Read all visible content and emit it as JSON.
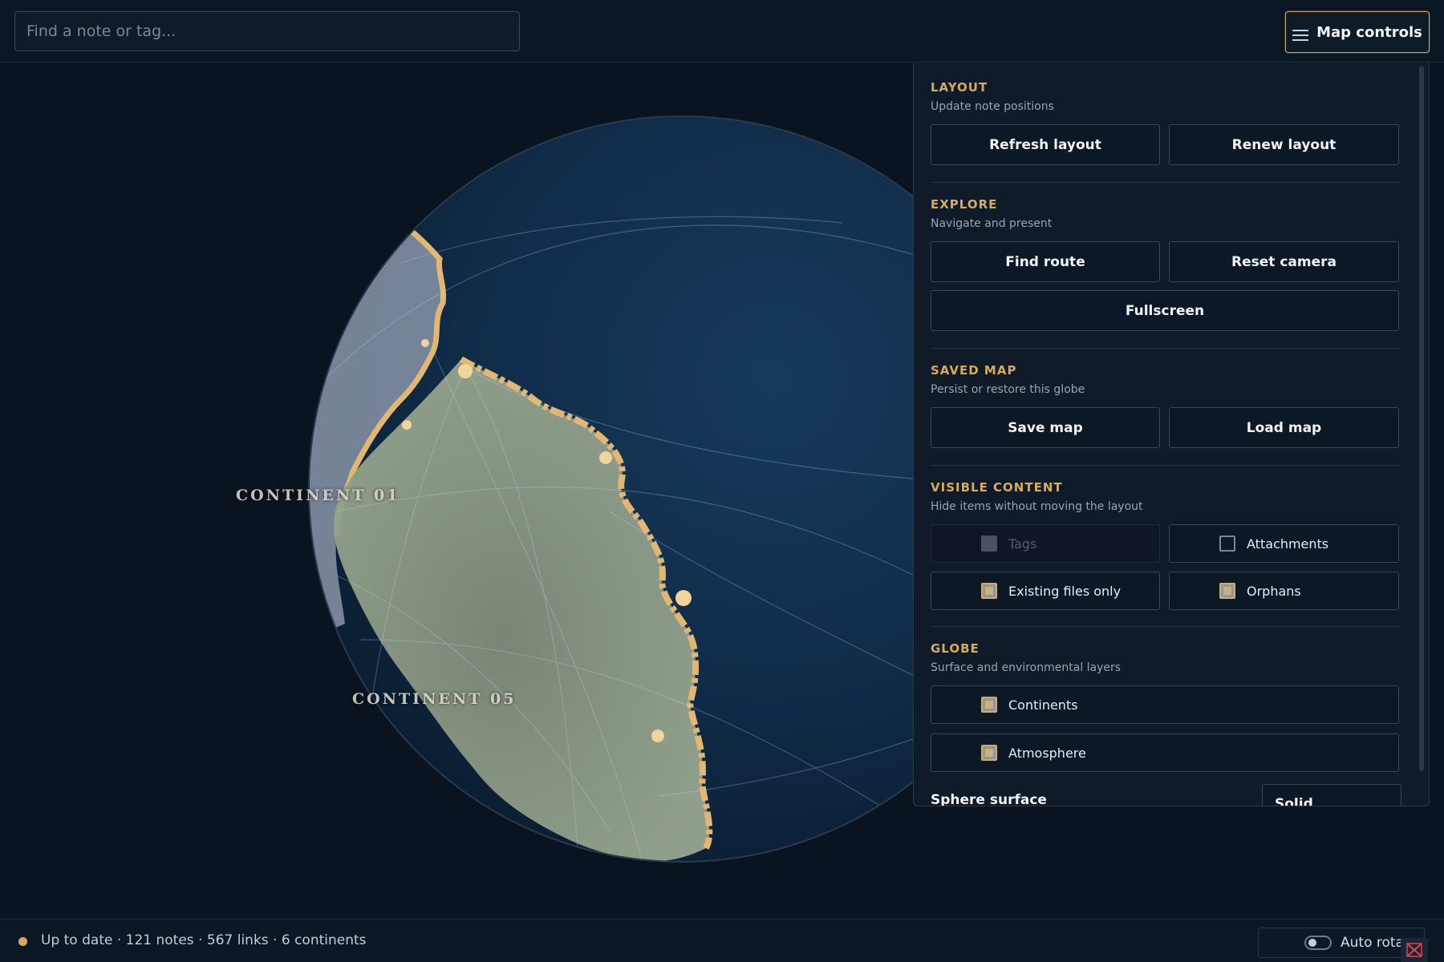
{
  "search": {
    "placeholder": "Find a note or tag..."
  },
  "header": {
    "map_controls_label": "Map controls",
    "map_controls_icon": "hamburger-icon"
  },
  "globe": {
    "continent_labels": [
      "CONTINENT 01",
      "CONTINENT 05"
    ]
  },
  "panel": {
    "layout": {
      "title": "LAYOUT",
      "subtitle": "Update note positions",
      "buttons": [
        "Refresh layout",
        "Renew layout"
      ]
    },
    "explore": {
      "title": "EXPLORE",
      "subtitle": "Navigate and present",
      "buttons": [
        "Find route",
        "Reset camera",
        "Fullscreen"
      ]
    },
    "saved_map": {
      "title": "SAVED MAP",
      "subtitle": "Persist or restore this globe",
      "buttons": [
        "Save map",
        "Load map"
      ]
    },
    "visible_content": {
      "title": "VISIBLE CONTENT",
      "subtitle": "Hide items without moving the layout",
      "toggles": [
        {
          "label": "Tags",
          "checked": true,
          "disabled": true
        },
        {
          "label": "Attachments",
          "checked": false,
          "disabled": false
        },
        {
          "label": "Existing files only",
          "checked": true,
          "disabled": false
        },
        {
          "label": "Orphans",
          "checked": true,
          "disabled": false
        }
      ]
    },
    "globe_section": {
      "title": "GLOBE",
      "subtitle": "Surface and environmental layers",
      "toggles": [
        {
          "label": "Continents",
          "checked": true
        },
        {
          "label": "Atmosphere",
          "checked": true
        }
      ]
    },
    "sphere_surface": {
      "label": "Sphere surface",
      "value": "Solid"
    }
  },
  "status": {
    "text": "Up to date · 121 notes · 567 links · 6 continents",
    "auto_rotate_label": "Auto rota",
    "auto_rotate_on": false
  },
  "colors": {
    "accent": "#d7ab5c",
    "background": "#0a1421",
    "ocean": "#12304d",
    "land": "#8c9a85",
    "coast": "#e3b772"
  }
}
